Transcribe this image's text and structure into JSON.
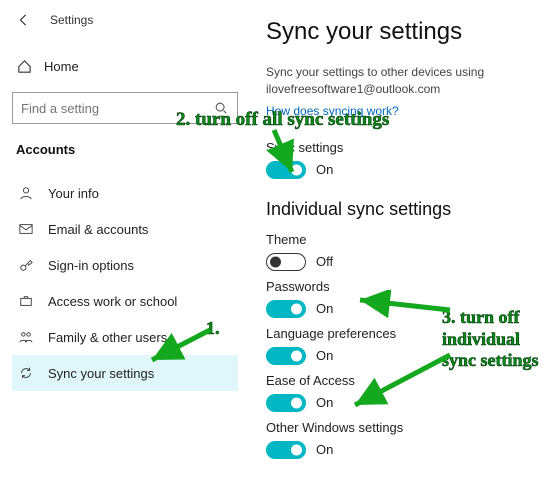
{
  "sidebar": {
    "back_title": "Settings",
    "home": "Home",
    "search_placeholder": "Find a setting",
    "section": "Accounts",
    "items": [
      {
        "label": "Your info"
      },
      {
        "label": "Email & accounts"
      },
      {
        "label": "Sign-in options"
      },
      {
        "label": "Access work or school"
      },
      {
        "label": "Family & other users"
      },
      {
        "label": "Sync your settings"
      }
    ]
  },
  "main": {
    "title": "Sync your settings",
    "description": "Sync your settings to other devices using ilovefreesoftware1@outlook.com",
    "link": "How does syncing work?",
    "sync_label": "Sync settings",
    "sync_state": "On",
    "individual_header": "Individual sync settings",
    "settings": [
      {
        "label": "Theme",
        "state": "Off",
        "on": false
      },
      {
        "label": "Passwords",
        "state": "On",
        "on": true
      },
      {
        "label": "Language preferences",
        "state": "On",
        "on": true
      },
      {
        "label": "Ease of Access",
        "state": "On",
        "on": true
      },
      {
        "label": "Other Windows settings",
        "state": "On",
        "on": true
      }
    ]
  },
  "annotations": {
    "n1": "1.",
    "n2": "2. turn off all sync settings",
    "n3": "3. turn off individual sync settings"
  }
}
